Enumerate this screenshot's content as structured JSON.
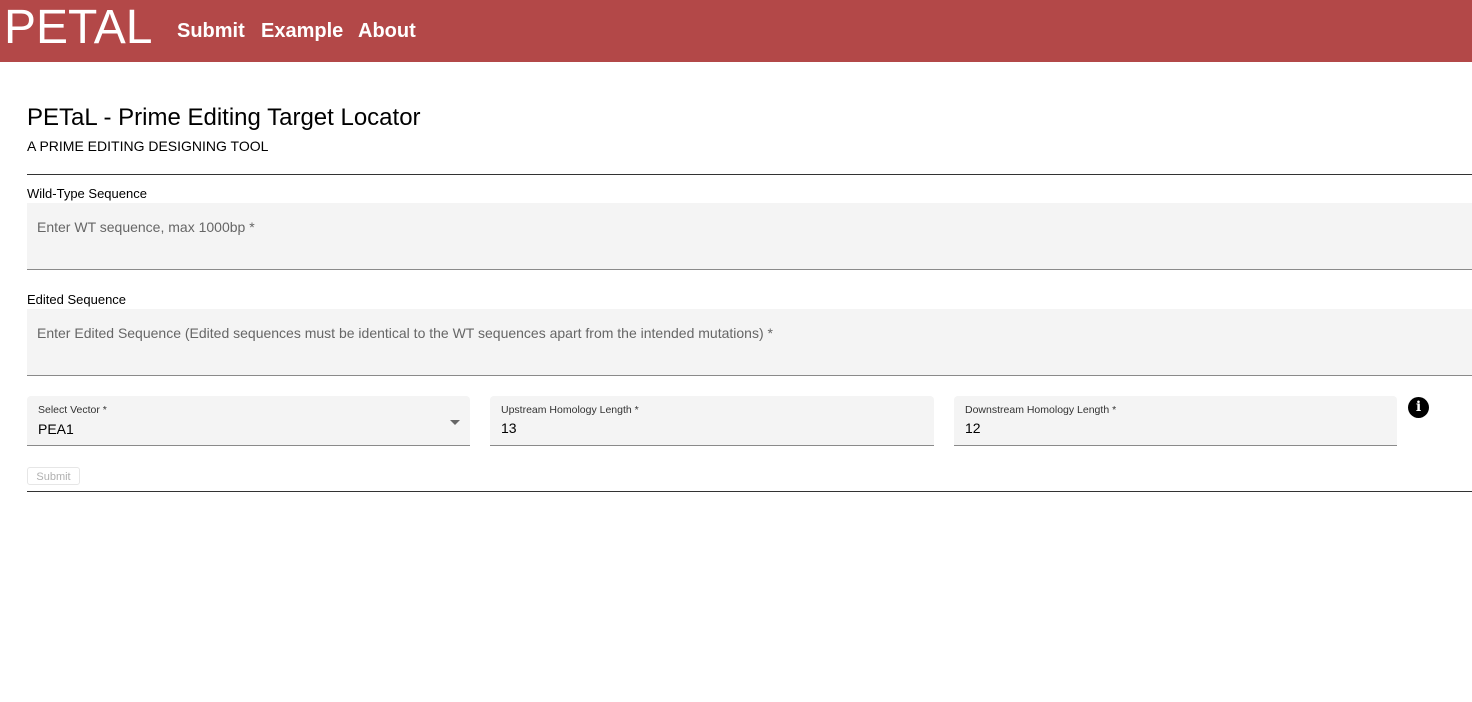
{
  "header": {
    "brand": "PETAL",
    "nav": [
      {
        "label": "Submit"
      },
      {
        "label": "Example"
      },
      {
        "label": "About"
      }
    ],
    "background_color": "#b34848"
  },
  "page": {
    "title": "PETaL - Prime Editing Target Locator",
    "subtitle": "A PRIME EDITING DESIGNING TOOL"
  },
  "form": {
    "wt": {
      "label": "Wild-Type Sequence",
      "placeholder": "Enter WT sequence, max 1000bp *",
      "value": ""
    },
    "edited": {
      "label": "Edited Sequence",
      "placeholder": "Enter Edited Sequence (Edited sequences must be identical to the WT sequences apart from the intended mutations) *",
      "value": ""
    },
    "vector": {
      "label": "Select Vector *",
      "value": "PEA1"
    },
    "upstream": {
      "label": "Upstream Homology Length *",
      "value": "13"
    },
    "downstream": {
      "label": "Downstream Homology Length *",
      "value": "12"
    },
    "info_icon": "info-icon",
    "info_glyph": "i",
    "submit_label": "Submit"
  }
}
